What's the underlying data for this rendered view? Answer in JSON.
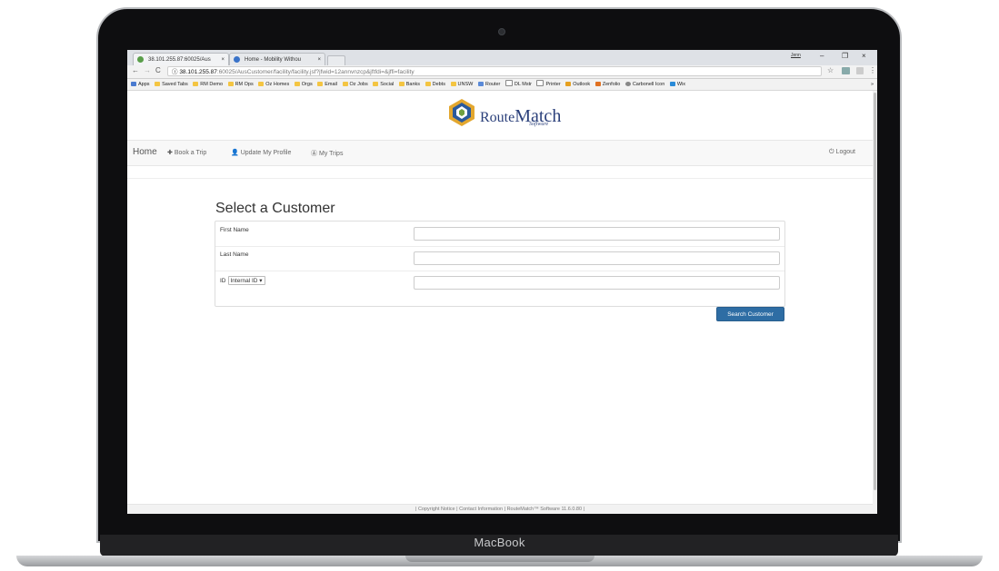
{
  "device": {
    "label": "MacBook"
  },
  "browser": {
    "tabs": [
      {
        "title": "38.101.255.87:60025/Aus",
        "close": "×"
      },
      {
        "title": "Home - Mobility Withou",
        "close": "×"
      }
    ],
    "user_badge": "Jenn",
    "window_controls": {
      "minimize": "–",
      "restore": "❐",
      "close": "×"
    },
    "nav": {
      "back": "←",
      "forward": "→",
      "reload": "C"
    },
    "address": {
      "host": "38.101.255.87",
      "path": ":60025/AusCustomer/facility/facility.jsf?jfwid=12annvnzcp&jftfdi=&jffi=facility"
    },
    "bookmarks": [
      "Apps",
      "Saved Tabs",
      "RM Demo",
      "RM Ops",
      "Oz Homes",
      "Orgs",
      "Email",
      "Oz Jobs",
      "Social",
      "Banks",
      "Debts",
      "UNSW",
      "Router",
      "DL Mstr",
      "Printer",
      "Outlook",
      "Zenfolio",
      "Carbonell Icon",
      "Wix"
    ],
    "bookmarks_more": "»"
  },
  "logo": {
    "word1": "Route",
    "word2": "Match",
    "sub": "Software"
  },
  "navbar": {
    "home": "Home",
    "book_trip": "Book a Trip",
    "update_profile": "Update My Profile",
    "my_trips": "My Trips",
    "logout": "Logout"
  },
  "form": {
    "title": "Select a Customer",
    "fields": [
      {
        "label": "First Name",
        "value": ""
      },
      {
        "label": "Last Name",
        "value": ""
      },
      {
        "label": "ID",
        "select_value": "Internal ID ▾",
        "value": ""
      }
    ],
    "search_button": "Search Customer"
  },
  "footer": {
    "text": "| Copyright Notice | Contact Information | RouteMatch™ Software 11.6.0.80 |"
  },
  "colors": {
    "brand_blue": "#2a3f7a",
    "button": "#2e6da4"
  }
}
